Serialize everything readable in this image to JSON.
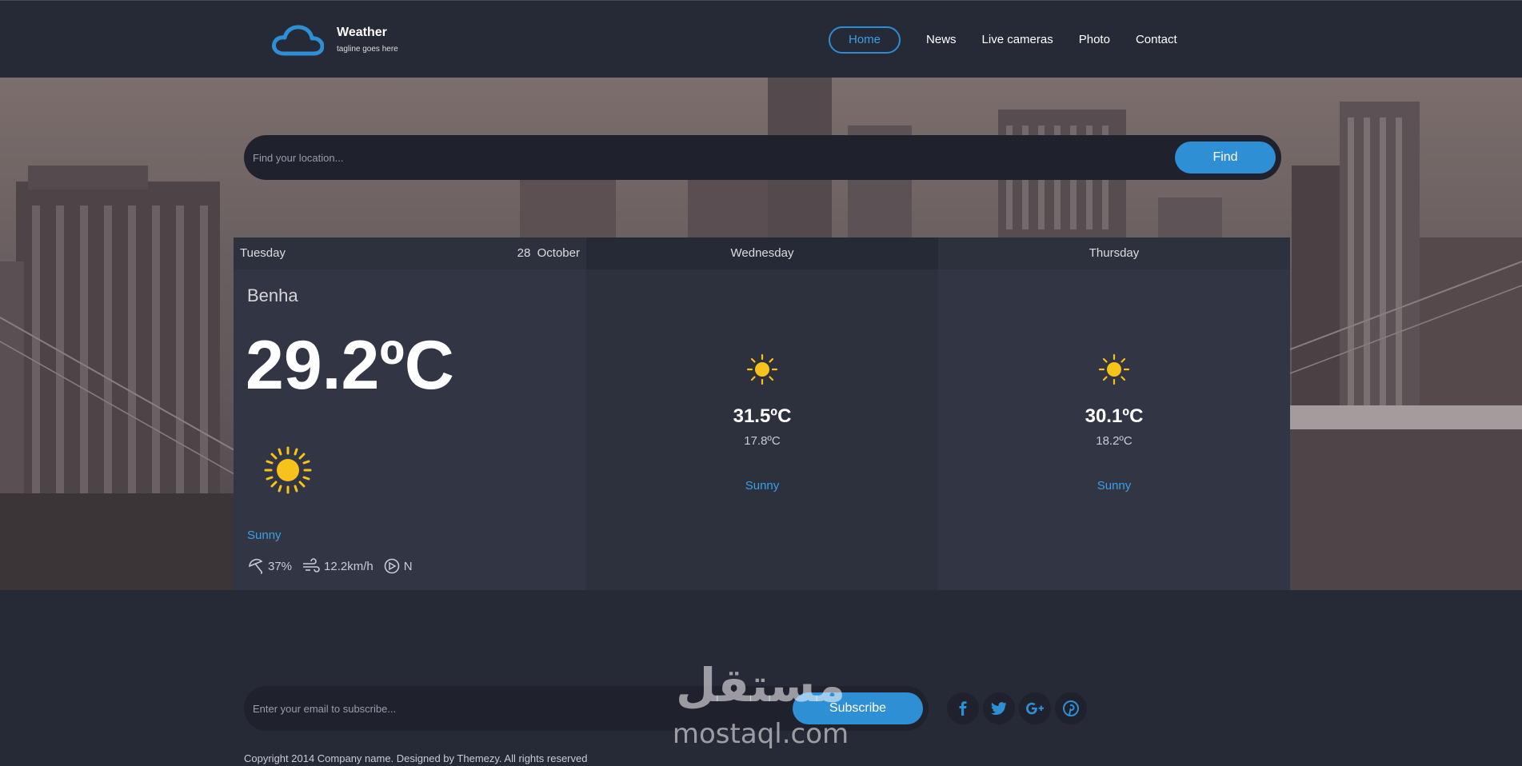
{
  "brand": {
    "title": "Weather",
    "tagline": "tagline goes here",
    "logo_icon": "cloud-icon",
    "accent": "#2f8fd5"
  },
  "nav": {
    "items": [
      {
        "label": "Home",
        "active": true
      },
      {
        "label": "News",
        "active": false
      },
      {
        "label": "Live cameras",
        "active": false
      },
      {
        "label": "Photo",
        "active": false
      },
      {
        "label": "Contact",
        "active": false
      }
    ]
  },
  "search": {
    "placeholder": "Find your location...",
    "button": "Find"
  },
  "today": {
    "day": "Tuesday",
    "date": "28  October",
    "location": "Benha",
    "temp": "29.2ºC",
    "icon": "sun-icon",
    "condition": "Sunny",
    "humidity": "37%",
    "wind": "12.2km/h",
    "direction": "N"
  },
  "forecast": [
    {
      "day": "Wednesday",
      "icon": "sun-icon",
      "high": "31.5ºC",
      "low": "17.8ºC",
      "condition": "Sunny"
    },
    {
      "day": "Thursday",
      "icon": "sun-icon",
      "high": "30.1ºC",
      "low": "18.2ºC",
      "condition": "Sunny"
    }
  ],
  "subscribe": {
    "placeholder": "Enter your email to subscribe...",
    "button": "Subscribe"
  },
  "social": [
    "facebook-icon",
    "twitter-icon",
    "google-plus-icon",
    "pinterest-icon"
  ],
  "footer": {
    "copyright": "Copyright 2014 Company name. Designed by Themezy. All rights reserved"
  },
  "watermark": {
    "arabic": "مستقل",
    "latin": "mostaql.com"
  }
}
